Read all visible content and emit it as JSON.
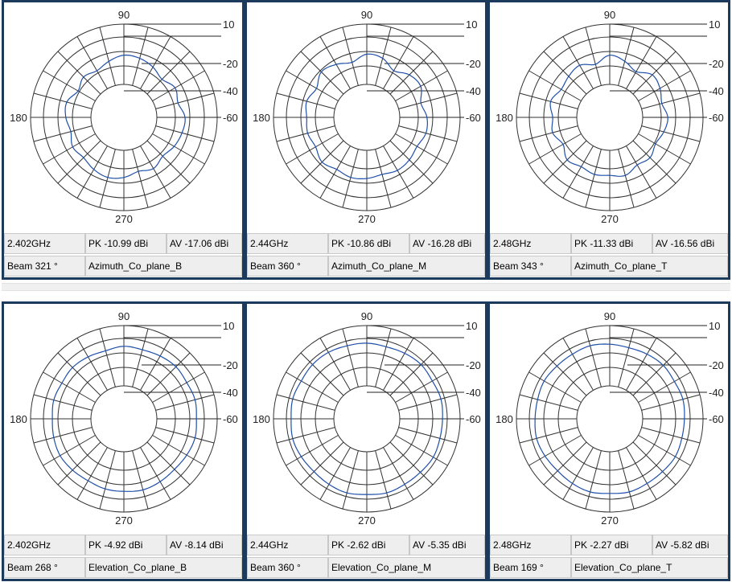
{
  "chart_data": [
    {
      "type": "polar",
      "freq": "2.402GHz",
      "pk": "PK -10.99 dBi",
      "av": "AV -17.06 dBi",
      "beam": "Beam 321 °",
      "plane": "Azimuth_Co_plane_B",
      "angle_labels": [
        "90",
        "180",
        "270"
      ],
      "ring_labels": [
        "10",
        "-20",
        "-40",
        "-60"
      ],
      "rlim": [
        -80,
        10
      ],
      "series_color": "#1f4fa8",
      "points": [
        [
          0,
          -21
        ],
        [
          15,
          -26
        ],
        [
          30,
          -23
        ],
        [
          45,
          -28
        ],
        [
          60,
          -24
        ],
        [
          75,
          -21
        ],
        [
          90,
          -20
        ],
        [
          105,
          -24
        ],
        [
          120,
          -28
        ],
        [
          135,
          -25
        ],
        [
          150,
          -29
        ],
        [
          165,
          -23
        ],
        [
          180,
          -24
        ],
        [
          195,
          -27
        ],
        [
          210,
          -23
        ],
        [
          225,
          -25
        ],
        [
          240,
          -22
        ],
        [
          255,
          -20
        ],
        [
          270,
          -22
        ],
        [
          285,
          -26
        ],
        [
          300,
          -23
        ],
        [
          315,
          -27
        ],
        [
          330,
          -24
        ],
        [
          345,
          -22
        ]
      ]
    },
    {
      "type": "polar",
      "freq": "2.44GHz",
      "pk": "PK -10.86 dBi",
      "av": "AV -16.28 dBi",
      "beam": "Beam 360 °",
      "plane": "Azimuth_Co_plane_M",
      "angle_labels": [
        "90",
        "180",
        "270"
      ],
      "ring_labels": [
        "10",
        "-20",
        "-40",
        "-60"
      ],
      "rlim": [
        -80,
        10
      ],
      "series_color": "#1f4fa8",
      "points": [
        [
          0,
          -22
        ],
        [
          15,
          -26
        ],
        [
          30,
          -20
        ],
        [
          45,
          -22
        ],
        [
          60,
          -28
        ],
        [
          75,
          -21
        ],
        [
          90,
          -19
        ],
        [
          105,
          -25
        ],
        [
          120,
          -21
        ],
        [
          135,
          -18
        ],
        [
          150,
          -24
        ],
        [
          165,
          -20
        ],
        [
          180,
          -22
        ],
        [
          195,
          -21
        ],
        [
          210,
          -23
        ],
        [
          225,
          -19
        ],
        [
          240,
          -22
        ],
        [
          255,
          -20
        ],
        [
          270,
          -21
        ],
        [
          285,
          -23
        ],
        [
          300,
          -21
        ],
        [
          315,
          -22
        ],
        [
          330,
          -24
        ],
        [
          345,
          -21
        ]
      ]
    },
    {
      "type": "polar",
      "freq": "2.48GHz",
      "pk": "PK -11.33 dBi",
      "av": "AV -16.56 dBi",
      "beam": "Beam 343 °",
      "plane": "Azimuth_Co_plane_T",
      "angle_labels": [
        "90",
        "180",
        "270"
      ],
      "ring_labels": [
        "10",
        "-20",
        "-40",
        "-60"
      ],
      "rlim": [
        -80,
        10
      ],
      "series_color": "#1f4fa8",
      "points": [
        [
          0,
          -24
        ],
        [
          15,
          -28
        ],
        [
          30,
          -24
        ],
        [
          45,
          -22
        ],
        [
          60,
          -29
        ],
        [
          75,
          -24
        ],
        [
          90,
          -20
        ],
        [
          105,
          -27
        ],
        [
          120,
          -22
        ],
        [
          135,
          -24
        ],
        [
          150,
          -26
        ],
        [
          165,
          -21
        ],
        [
          180,
          -25
        ],
        [
          195,
          -23
        ],
        [
          210,
          -28
        ],
        [
          225,
          -22
        ],
        [
          240,
          -25
        ],
        [
          255,
          -23
        ],
        [
          270,
          -24
        ],
        [
          285,
          -22
        ],
        [
          300,
          -27
        ],
        [
          315,
          -25
        ],
        [
          330,
          -29
        ],
        [
          345,
          -26
        ]
      ]
    },
    {
      "type": "polar",
      "freq": "2.402GHz",
      "pk": "PK -4.92 dBi",
      "av": "AV -8.14 dBi",
      "beam": "Beam 268 °",
      "plane": "Elevation_Co_plane_B",
      "angle_labels": [
        "90",
        "180",
        "270"
      ],
      "ring_labels": [
        "10",
        "-20",
        "-40",
        "-60"
      ],
      "rlim": [
        -80,
        10
      ],
      "series_color": "#1f4fa8",
      "points": [
        [
          0,
          -10
        ],
        [
          15,
          -9
        ],
        [
          30,
          -10
        ],
        [
          45,
          -9
        ],
        [
          60,
          -10
        ],
        [
          75,
          -11
        ],
        [
          90,
          -10
        ],
        [
          105,
          -12
        ],
        [
          120,
          -11
        ],
        [
          135,
          -10
        ],
        [
          150,
          -11
        ],
        [
          165,
          -10
        ],
        [
          180,
          -11
        ],
        [
          195,
          -10
        ],
        [
          210,
          -9
        ],
        [
          225,
          -10
        ],
        [
          240,
          -11
        ],
        [
          255,
          -10
        ],
        [
          270,
          -10
        ],
        [
          285,
          -9
        ],
        [
          300,
          -10
        ],
        [
          315,
          -11
        ],
        [
          330,
          -10
        ],
        [
          345,
          -9
        ]
      ]
    },
    {
      "type": "polar",
      "freq": "2.44GHz",
      "pk": "PK -2.62 dBi",
      "av": "AV -5.35 dBi",
      "beam": "Beam 360 °",
      "plane": "Elevation_Co_plane_M",
      "angle_labels": [
        "90",
        "180",
        "270"
      ],
      "ring_labels": [
        "10",
        "-20",
        "-40",
        "-60"
      ],
      "rlim": [
        -80,
        10
      ],
      "series_color": "#1f4fa8",
      "points": [
        [
          0,
          -7
        ],
        [
          15,
          -6
        ],
        [
          30,
          -7
        ],
        [
          45,
          -6
        ],
        [
          60,
          -7
        ],
        [
          75,
          -8
        ],
        [
          90,
          -7
        ],
        [
          105,
          -7
        ],
        [
          120,
          -6
        ],
        [
          135,
          -6
        ],
        [
          150,
          -7
        ],
        [
          165,
          -6
        ],
        [
          180,
          -7
        ],
        [
          195,
          -6
        ],
        [
          210,
          -7
        ],
        [
          225,
          -8
        ],
        [
          240,
          -7
        ],
        [
          255,
          -6
        ],
        [
          270,
          -7
        ],
        [
          285,
          -6
        ],
        [
          300,
          -7
        ],
        [
          315,
          -7
        ],
        [
          330,
          -6
        ],
        [
          345,
          -7
        ]
      ]
    },
    {
      "type": "polar",
      "freq": "2.48GHz",
      "pk": "PK -2.27 dBi",
      "av": "AV -5.82 dBi",
      "beam": "Beam 169 °",
      "plane": "Elevation_Co_plane_T",
      "angle_labels": [
        "90",
        "180",
        "270"
      ],
      "ring_labels": [
        "10",
        "-20",
        "-40",
        "-60"
      ],
      "rlim": [
        -80,
        10
      ],
      "series_color": "#1f4fa8",
      "points": [
        [
          0,
          -8
        ],
        [
          15,
          -7
        ],
        [
          30,
          -8
        ],
        [
          45,
          -7
        ],
        [
          60,
          -8
        ],
        [
          75,
          -9
        ],
        [
          90,
          -8
        ],
        [
          105,
          -7
        ],
        [
          120,
          -8
        ],
        [
          135,
          -8
        ],
        [
          150,
          -7
        ],
        [
          165,
          -8
        ],
        [
          180,
          -8
        ],
        [
          195,
          -7
        ],
        [
          210,
          -8
        ],
        [
          225,
          -9
        ],
        [
          240,
          -8
        ],
        [
          255,
          -7
        ],
        [
          270,
          -8
        ],
        [
          285,
          -7
        ],
        [
          300,
          -8
        ],
        [
          315,
          -8
        ],
        [
          330,
          -7
        ],
        [
          345,
          -8
        ]
      ]
    }
  ]
}
